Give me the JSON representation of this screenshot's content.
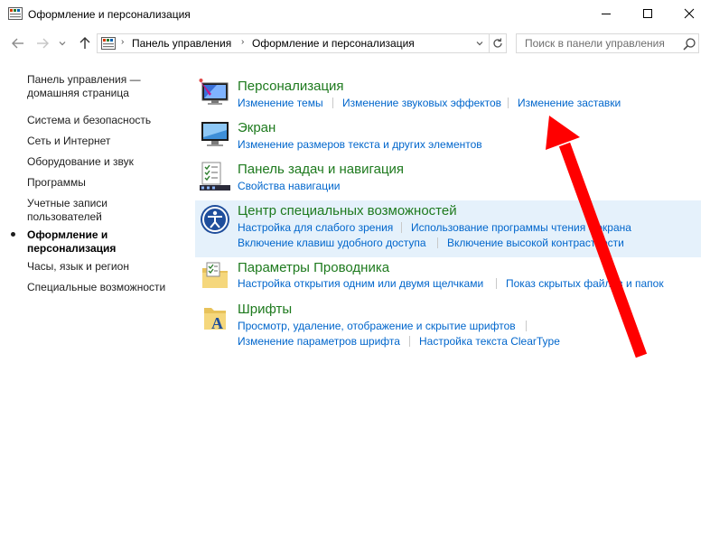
{
  "window": {
    "title": "Оформление и персонализация",
    "app_icon": "control-panel-icon"
  },
  "address_bar": {
    "breadcrumbs": [
      "Панель управления",
      "Оформление и персонализация"
    ],
    "search_placeholder": "Поиск в панели управления"
  },
  "left_pane": {
    "items": [
      {
        "label_lines": [
          "Панель управления —",
          "домашняя страница"
        ],
        "active": false
      },
      {
        "label_lines": [
          "Система и безопасность"
        ],
        "active": false
      },
      {
        "label_lines": [
          "Сеть и Интернет"
        ],
        "active": false
      },
      {
        "label_lines": [
          "Оборудование и звук"
        ],
        "active": false
      },
      {
        "label_lines": [
          "Программы"
        ],
        "active": false
      },
      {
        "label_lines": [
          "Учетные записи",
          "пользователей"
        ],
        "active": false
      },
      {
        "label_lines": [
          "Оформление и",
          "персонализация"
        ],
        "active": true
      },
      {
        "label_lines": [
          "Часы, язык и регион"
        ],
        "active": false
      },
      {
        "label_lines": [
          "Специальные возможности"
        ],
        "active": false
      }
    ]
  },
  "categories": [
    {
      "title": "Персонализация",
      "icon": "personalization-icon",
      "links": [
        [
          "Изменение темы",
          "Изменение звуковых эффектов",
          "Изменение заставки"
        ]
      ]
    },
    {
      "title": "Экран",
      "icon": "display-icon",
      "links": [
        [
          "Изменение размеров текста и других элементов"
        ]
      ]
    },
    {
      "title": "Панель задач и навигация",
      "icon": "taskbar-icon",
      "links": [
        [
          "Свойства навигации"
        ]
      ]
    },
    {
      "title": "Центр специальных возможностей",
      "icon": "ease-of-access-icon",
      "highlighted": true,
      "links": [
        [
          "Настройка для слабого зрения",
          "Использование программы чтения с экрана"
        ],
        [
          "Включение клавиш удобного доступа",
          "Включение высокой контрастности"
        ]
      ]
    },
    {
      "title": "Параметры Проводника",
      "icon": "explorer-options-icon",
      "links": [
        [
          "Настройка открытия одним или двумя щелчками",
          "Показ скрытых файлов и папок"
        ]
      ]
    },
    {
      "title": "Шрифты",
      "icon": "fonts-icon",
      "links": [
        [
          "Просмотр, удаление, отображение и скрытие шрифтов"
        ],
        [
          "Изменение параметров шрифта",
          "Настройка текста ClearType"
        ]
      ]
    }
  ],
  "annotation": {
    "arrow_color": "#ff0000",
    "points_to": "Изменение заставки"
  },
  "colors": {
    "category_title": "#1e7a1e",
    "link": "#0066cc",
    "highlight_bg": "#e5f1fb"
  }
}
